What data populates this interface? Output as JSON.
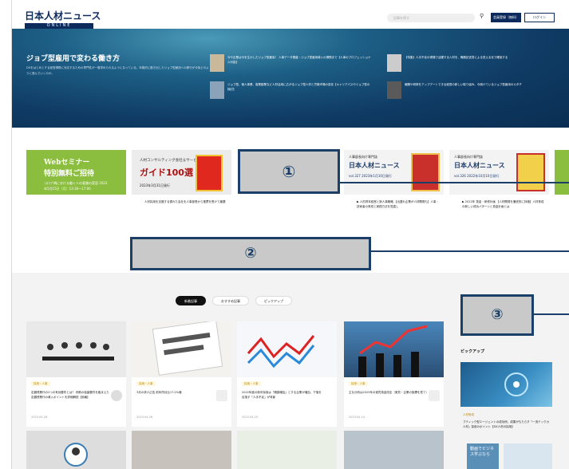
{
  "header": {
    "logo_jp": "日本人材ニュース",
    "logo_en": "ONLINE",
    "search_placeholder": "記事を探す",
    "register_label": "会員登録（無料）",
    "login_label": "ログイン"
  },
  "hero": {
    "title": "ジョブ型雇用で変わる働き方",
    "desc": "DXをはじめとする経営課題に対応するための専門性が一層求められるようになっている。本格的に動き出したジョブ型雇用への移行が今後どのように進んでいくのか。",
    "articles": [
      {
        "text": "今や企業は今を生かしたジョブ型雇用！ 人事データ基盤・ジョブ型雇用導入の課題まで【人事のプロフェッショナル対談】"
      },
      {
        "text": "【特集】人手不足の現場で活躍する人材を、職務記述書による見える化で確保する"
      },
      {
        "text": "ジョブ型、個人事業、複業副業など人材活用に広がるジョブ型人材と労働市場の変化【キャリアパスやジョブ型の検討】"
      },
      {
        "text": "報酬や研修をアップデートできる経営の新しい取り組み、今続けているジョブ型雇用のカタチ"
      }
    ]
  },
  "banners": [
    {
      "type": "web",
      "t1": "Webセミナー",
      "t2": "特別無料ご招待",
      "t3": "コロナ禍における働く人の意識の変容 2023年5月15日（月）13:30〜17:00",
      "caption": ""
    },
    {
      "type": "guide",
      "g1": "人材コンサルティング会社＆サービス",
      "g2": "ガイド100選",
      "g3": "2023年3月31日発行",
      "caption": "人材採用を支援する優れた会社を人事部長から推薦を受けて厳選"
    },
    {
      "type": "news",
      "n1": "人事部長向け専門誌",
      "n2": "日本人材ニュース",
      "n3": "vol.327 2023年1月10日発行",
      "n4": "",
      "caption": "▶ 人的資本経営と新人事戦略 【出遅れ企業が人材開発も】人事・技術者の育成と実践方法を見直し"
    },
    {
      "type": "news",
      "n1": "人事部長向け専門誌",
      "n2": "日本人材ニュース",
      "n3": "vol.326 2022年10月10日発行",
      "n4": "",
      "caption": "▶ 2022年 賃金・研修計画 【人材開発を徹底的に評価】人材育成の新しい成功パターンと賃金計画とは"
    }
  ],
  "callouts": {
    "c1": "①",
    "c2": "②",
    "c3": "③"
  },
  "tabs": [
    {
      "label": "新着記事",
      "active": true
    },
    {
      "label": "おすすめ記事",
      "active": false
    },
    {
      "label": "ピックアップ",
      "active": false
    }
  ],
  "articles": [
    {
      "tag": "採用・人事",
      "title": "定額残業代の2つの有効要件とは？ 判断の結論要件を踏まえた定額残業代の導入ポイントを詳細解説【前編】",
      "date": "2023.04.26",
      "img": "#e9e9e9"
    },
    {
      "tag": "採用・人事",
      "title": "3月の求人広告 前年同月比17.2%増",
      "date": "2023.04.26",
      "img": "#f4f2ee"
    },
    {
      "tag": "採用・人事",
      "title": "2022年度の新卒採用は「順調増加」とする企業が増加、下落を目指す「人手不足」が背景",
      "date": "2023.04.25",
      "img": "#f5f7fa"
    },
    {
      "tag": "採用・人事",
      "title": "主な分析は2023年の実質賃金改定（実質・企業の指標を見て）",
      "date": "2023.04.24",
      "img": "#3d6f99"
    }
  ],
  "sidebar": {
    "title": "ピックアップ",
    "tag": "人材育成",
    "text": "ブティック型エージェントの成功例、成果がもたらす「一流テックカ人材」採用のポイント【DX人材の採用】",
    "banner_text": "動画でビジネス学ぶなら"
  }
}
